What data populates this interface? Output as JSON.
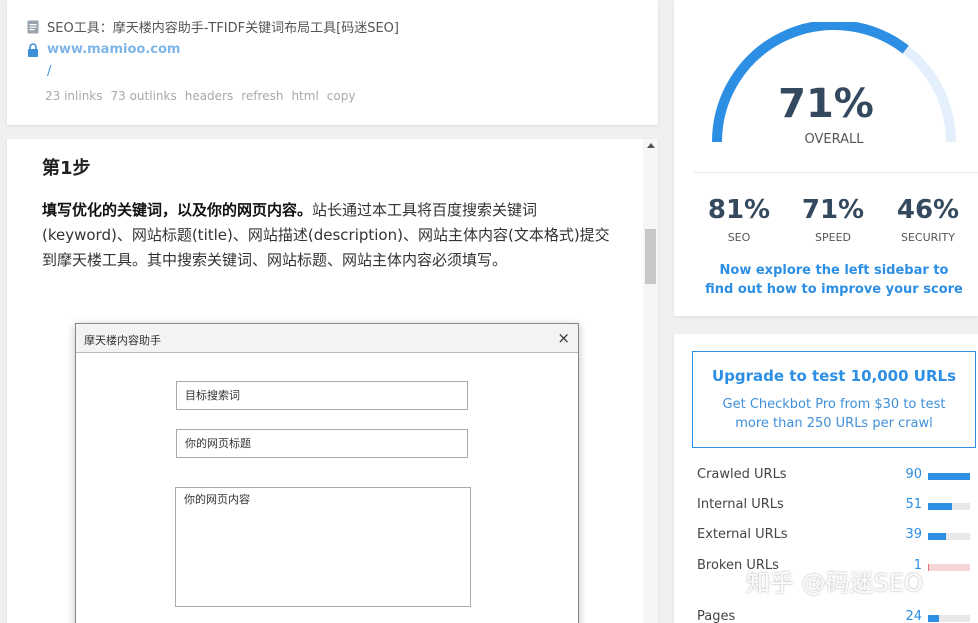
{
  "info": {
    "title": "SEO工具：摩天楼内容助手-TFIDF关键词布局工具[码迷SEO]",
    "url": "www.mamioo.com",
    "path": "/",
    "inlinks": "23 inlinks",
    "outlinks": "73 outlinks",
    "actions": [
      "headers",
      "refresh",
      "html",
      "copy"
    ],
    "icons": {
      "title": "document-icon",
      "url": "lock-icon"
    }
  },
  "article": {
    "step_title": "第1步",
    "para_bold": "填写优化的关键词，以及你的网页内容。",
    "para_text": "站长通过本工具将百度搜索关键词(keyword)、网站标题(title)、网站描述(description)、网站主体内容(文本格式)提交到摩天楼工具。其中搜索关键词、网站标题、网站主体内容必须填写。",
    "dialog": {
      "title": "摩天楼内容助手",
      "close": "×",
      "keyword_placeholder": "目标搜索词",
      "title_placeholder": "你的网页标题",
      "content_placeholder": "你的网页内容"
    }
  },
  "score": {
    "overall_value": "71%",
    "overall_label": "OVERALL",
    "overall_fraction": 0.71,
    "sub_scores": [
      {
        "value": "81%",
        "label": "SEO"
      },
      {
        "value": "71%",
        "label": "SPEED"
      },
      {
        "value": "46%",
        "label": "SECURITY"
      }
    ],
    "explore_text": "Now explore the left sidebar to find out how to improve your score",
    "colors": {
      "accent": "#2d8fe4",
      "track": "#e3f0fb"
    }
  },
  "stats": {
    "upgrade_title": "Upgrade to test 10,000 URLs",
    "upgrade_sub": "Get Checkbot Pro from $30 to test more than 250 URLs per crawl",
    "rows": [
      {
        "label": "Crawled URLs",
        "value": "90",
        "fraction": 1.0,
        "color": "#2d8fe4"
      },
      {
        "label": "Internal URLs",
        "value": "51",
        "fraction": 0.57,
        "color": "#2d8fe4"
      },
      {
        "label": "External URLs",
        "value": "39",
        "fraction": 0.43,
        "color": "#2d8fe4"
      },
      {
        "label": "Broken URLs",
        "value": "1",
        "fraction": 0.02,
        "color": "#e57373"
      },
      {
        "label": "Pages",
        "value": "24",
        "fraction": 0.27,
        "color": "#2d8fe4"
      }
    ]
  },
  "watermark": "知乎 @码迷SEO"
}
